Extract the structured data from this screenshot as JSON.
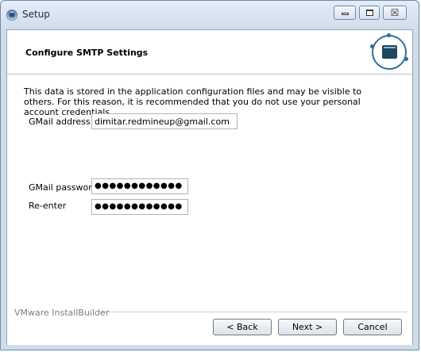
{
  "window": {
    "title": "Setup",
    "close_glyph": "☒"
  },
  "header": {
    "title": "Configure SMTP Settings",
    "logo_icon": "installer-screen-icon"
  },
  "content": {
    "intro_text": "This data is stored in the application configuration files and may be visible to others. For this reason, it is recommended that you do not use your personal account credentials.",
    "gmail_address_label": "GMail address",
    "gmail_address_value": "dimitar.redmineup@gmail.com",
    "gmail_password_label": "GMail password",
    "gmail_password_value": "●●●●●●●●●●●●",
    "reenter_label": "Re-enter",
    "reenter_value": "●●●●●●●●●●●●"
  },
  "footer": {
    "brand": "VMware InstallBuilder",
    "back_label": "< Back",
    "next_label": "Next >",
    "cancel_label": "Cancel"
  },
  "colors": {
    "title_bar": "#d6e2ef",
    "logo_accent": "#2f6f95"
  }
}
